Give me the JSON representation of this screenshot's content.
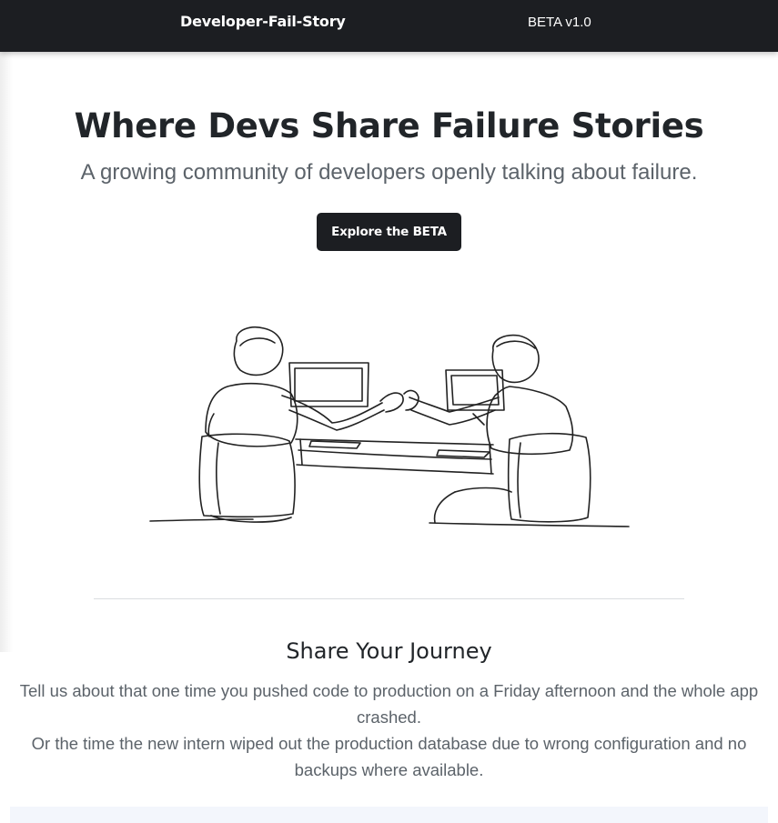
{
  "navbar": {
    "brand": "Developer-Fail-Story",
    "version": "BETA v1.0"
  },
  "hero": {
    "title": "Where Devs Share Failure Stories",
    "subtitle": "A growing community of developers openly talking about failure.",
    "cta_label": "Explore the BETA",
    "illustration": "line-art-developers-fist-bump"
  },
  "journey": {
    "title": "Share Your Journey",
    "paragraph_1": "Tell us about that one time you pushed code to production on a Friday afternoon and the whole app crashed.",
    "paragraph_2": "Or the time the new intern wiped out the production database due to wrong configuration and no backups where available."
  },
  "colors": {
    "navbar_bg": "#1c1e22",
    "heading": "#212529",
    "muted_text": "#5c636a",
    "card_bg": "#f3f6fc"
  }
}
